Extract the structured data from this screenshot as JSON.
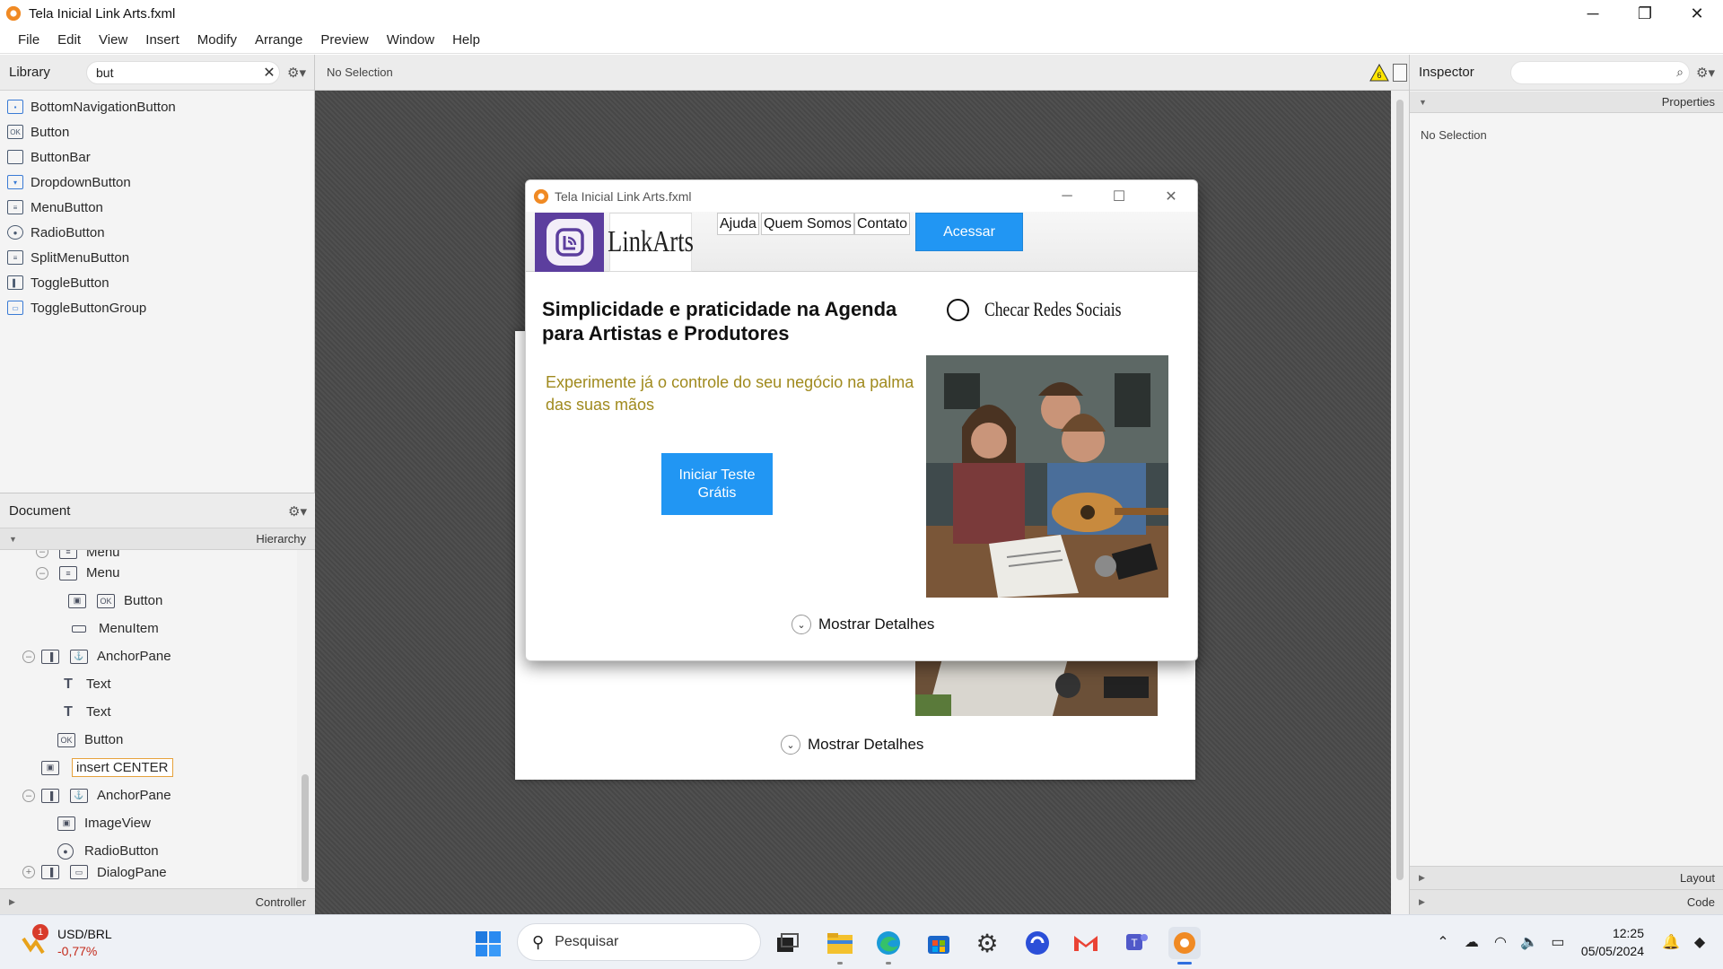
{
  "window": {
    "title": "Tela Inicial Link Arts.fxml"
  },
  "menu": [
    "File",
    "Edit",
    "View",
    "Insert",
    "Modify",
    "Arrange",
    "Preview",
    "Window",
    "Help"
  ],
  "library": {
    "title": "Library",
    "search_value": "but",
    "items": [
      "BottomNavigationButton",
      "Button",
      "ButtonBar",
      "DropdownButton",
      "MenuButton",
      "RadioButton",
      "SplitMenuButton",
      "ToggleButton",
      "ToggleButtonGroup"
    ]
  },
  "document": {
    "title": "Document",
    "hierarchy_label": "Hierarchy",
    "controller_label": "Controller",
    "tree": [
      {
        "label": "Menu"
      },
      {
        "label": "Menu"
      },
      {
        "label": "Button",
        "icon_text": "OK"
      },
      {
        "label": "MenuItem"
      },
      {
        "label": "AnchorPane"
      },
      {
        "label": "Text"
      },
      {
        "label": "Text"
      },
      {
        "label": "Button",
        "icon_text": "OK"
      },
      {
        "label": "insert CENTER"
      },
      {
        "label": "AnchorPane"
      },
      {
        "label": "ImageView"
      },
      {
        "label": "RadioButton"
      },
      {
        "label": "DialogPane"
      }
    ]
  },
  "canvas": {
    "selection_text": "No Selection",
    "warning_count": "6"
  },
  "preview": {
    "title": "Tela Inicial Link Arts.fxml",
    "brand": "LinkArts",
    "nav": [
      "Ajuda",
      "Quem Somos",
      "Contato"
    ],
    "access_button": "Acessar",
    "headline": "Simplicidade e praticidade na Agenda para Artistas e Produtores",
    "subtext": "Experimente já o controle do seu negócio na palma das suas mãos",
    "trial_button_line1": "Iniciar Teste",
    "trial_button_line2": "Grátis",
    "radio_label": "Checar Redes Sociais",
    "details_label": "Mostrar Detalhes"
  },
  "behind": {
    "details_label": "Mostrar Detalhes"
  },
  "inspector": {
    "title": "Inspector",
    "properties_label": "Properties",
    "selection_text": "No Selection",
    "layout_label": "Layout",
    "code_label": "Code"
  },
  "taskbar": {
    "ticker_label": "USD/BRL",
    "ticker_change": "-0,77%",
    "notification_count": "1",
    "search_placeholder": "Pesquisar",
    "time": "12:25",
    "date": "05/05/2024"
  },
  "colors": {
    "accent_blue": "#2196f3",
    "brand_purple": "#5c3e9e",
    "subtext_gold": "#a08a1e"
  }
}
